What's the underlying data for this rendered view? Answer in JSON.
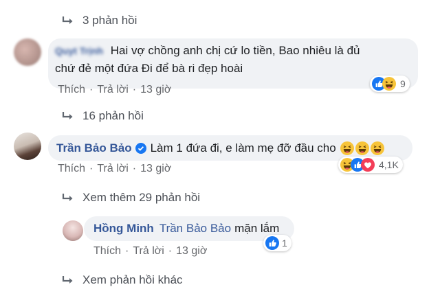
{
  "thread1": {
    "replies_label": "3 phản hồi"
  },
  "comment1": {
    "author": "Quyt Trịnh",
    "text_line1": "Hai vợ chồng anh chị cứ lo tiền, Bao nhiêu là đủ",
    "text_line2": "chứ đẻ một đứa Đi để bà ri đẹp hoài",
    "like_label": "Thích",
    "reply_label": "Trả lời",
    "time": "13 giờ",
    "reactions": [
      "like",
      "haha"
    ],
    "reaction_count": "9",
    "replies_label": "16 phản hồi"
  },
  "comment2": {
    "author": "Trần Bảo Bảo",
    "verified": true,
    "text": "Làm 1 đứa đi, e làm mẹ đỡ đầu cho",
    "emojis": [
      "haha",
      "haha",
      "haha"
    ],
    "like_label": "Thích",
    "reply_label": "Trả lời",
    "time": "13 giờ",
    "reactions": [
      "haha",
      "like",
      "love"
    ],
    "reaction_count": "4,1K",
    "more_replies_label": "Xem thêm 29 phản hồi"
  },
  "reply1": {
    "author": "Hồng Minh",
    "tag": "Trần Bảo Bảo",
    "text": "mặn lắm",
    "like_label": "Thích",
    "reply_label": "Trả lời",
    "time": "13 giờ",
    "reactions": [
      "like"
    ],
    "reaction_count": "1"
  },
  "other_replies_label": "Xem phản hồi khác",
  "colors": {
    "link": "#365899",
    "bubble": "#f0f2f5",
    "like": "#1877f2",
    "haha": "#f7c43a",
    "love": "#f33e58"
  }
}
